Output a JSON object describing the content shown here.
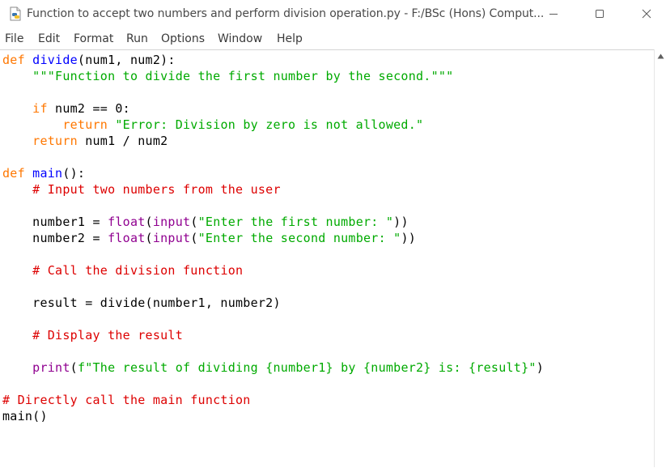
{
  "window": {
    "title": "Function to accept two numbers and perform division operation.py - F:/BSc (Hons) Comput...",
    "icon": "python-idle-file-icon",
    "controls": {
      "minimize": "minimize-icon",
      "maximize": "maximize-icon",
      "close": "close-icon"
    }
  },
  "menu": [
    "File",
    "Edit",
    "Format",
    "Run",
    "Options",
    "Window",
    "Help"
  ],
  "syntax_colors": {
    "keyword": "#ff7700",
    "builtin": "#900090",
    "definition": "#0000ff",
    "string": "#00aa00",
    "comment": "#dd0000",
    "default": "#000000"
  },
  "code": {
    "lines": [
      [
        {
          "t": "kw",
          "v": "def"
        },
        {
          "t": "plain",
          "v": " "
        },
        {
          "t": "def",
          "v": "divide"
        },
        {
          "t": "plain",
          "v": "(num1, num2):"
        }
      ],
      [
        {
          "t": "plain",
          "v": "    "
        },
        {
          "t": "str",
          "v": "\"\"\"Function to divide the first number by the second.\"\"\""
        }
      ],
      [],
      [
        {
          "t": "plain",
          "v": "    "
        },
        {
          "t": "kw",
          "v": "if"
        },
        {
          "t": "plain",
          "v": " num2 == 0:"
        }
      ],
      [
        {
          "t": "plain",
          "v": "        "
        },
        {
          "t": "kw",
          "v": "return"
        },
        {
          "t": "plain",
          "v": " "
        },
        {
          "t": "str",
          "v": "\"Error: Division by zero is not allowed.\""
        }
      ],
      [
        {
          "t": "plain",
          "v": "    "
        },
        {
          "t": "kw",
          "v": "return"
        },
        {
          "t": "plain",
          "v": " num1 / num2"
        }
      ],
      [],
      [
        {
          "t": "kw",
          "v": "def"
        },
        {
          "t": "plain",
          "v": " "
        },
        {
          "t": "def",
          "v": "main"
        },
        {
          "t": "plain",
          "v": "():"
        }
      ],
      [
        {
          "t": "plain",
          "v": "    "
        },
        {
          "t": "cmt",
          "v": "# Input two numbers from the user"
        }
      ],
      [],
      [
        {
          "t": "plain",
          "v": "    number1 = "
        },
        {
          "t": "bi",
          "v": "float"
        },
        {
          "t": "plain",
          "v": "("
        },
        {
          "t": "bi",
          "v": "input"
        },
        {
          "t": "plain",
          "v": "("
        },
        {
          "t": "str",
          "v": "\"Enter the first number: \""
        },
        {
          "t": "plain",
          "v": "))"
        }
      ],
      [
        {
          "t": "plain",
          "v": "    number2 = "
        },
        {
          "t": "bi",
          "v": "float"
        },
        {
          "t": "plain",
          "v": "("
        },
        {
          "t": "bi",
          "v": "input"
        },
        {
          "t": "plain",
          "v": "("
        },
        {
          "t": "str",
          "v": "\"Enter the second number: \""
        },
        {
          "t": "plain",
          "v": "))"
        }
      ],
      [],
      [
        {
          "t": "plain",
          "v": "    "
        },
        {
          "t": "cmt",
          "v": "# Call the division function"
        }
      ],
      [],
      [
        {
          "t": "plain",
          "v": "    result = divide(number1, number2)"
        }
      ],
      [],
      [
        {
          "t": "plain",
          "v": "    "
        },
        {
          "t": "cmt",
          "v": "# Display the result"
        }
      ],
      [],
      [
        {
          "t": "plain",
          "v": "    "
        },
        {
          "t": "bi",
          "v": "print"
        },
        {
          "t": "plain",
          "v": "("
        },
        {
          "t": "str",
          "v": "f\"The result of dividing {number1} by {number2} is: {result}\""
        },
        {
          "t": "plain",
          "v": ")"
        }
      ],
      [],
      [
        {
          "t": "cmt",
          "v": "# Directly call the main function"
        }
      ],
      [
        {
          "t": "plain",
          "v": "main()"
        }
      ]
    ]
  }
}
